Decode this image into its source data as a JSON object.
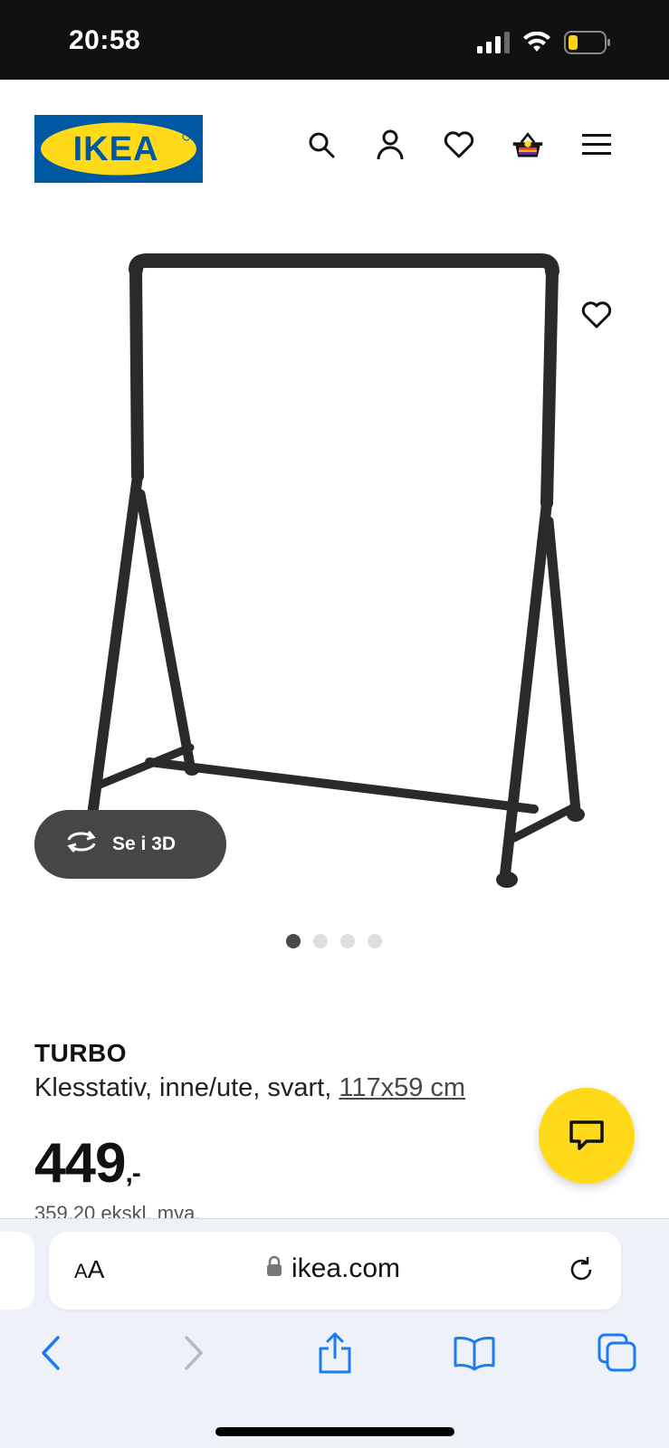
{
  "status_bar": {
    "time": "20:58"
  },
  "header": {
    "logo_text": "IKEA",
    "icons": [
      "search-icon",
      "user-icon",
      "heart-icon",
      "basket-icon",
      "menu-icon"
    ]
  },
  "gallery": {
    "view_3d_label": "Se i 3D",
    "slide_count": 4,
    "active_slide": 1
  },
  "product": {
    "name": "TURBO",
    "description": "Klesstativ, inne/ute, svart,",
    "size": "117x59 cm",
    "price": "449",
    "price_suffix": ",-",
    "price_ex_vat": "359,20 ekskl. mva."
  },
  "browser": {
    "aa_label_small": "A",
    "aa_label_large": "A",
    "url": "ikea.com"
  },
  "colors": {
    "ikea_blue": "#0058a3",
    "ikea_yellow": "#ffda1a",
    "browser_blue": "#1a7cf4"
  }
}
